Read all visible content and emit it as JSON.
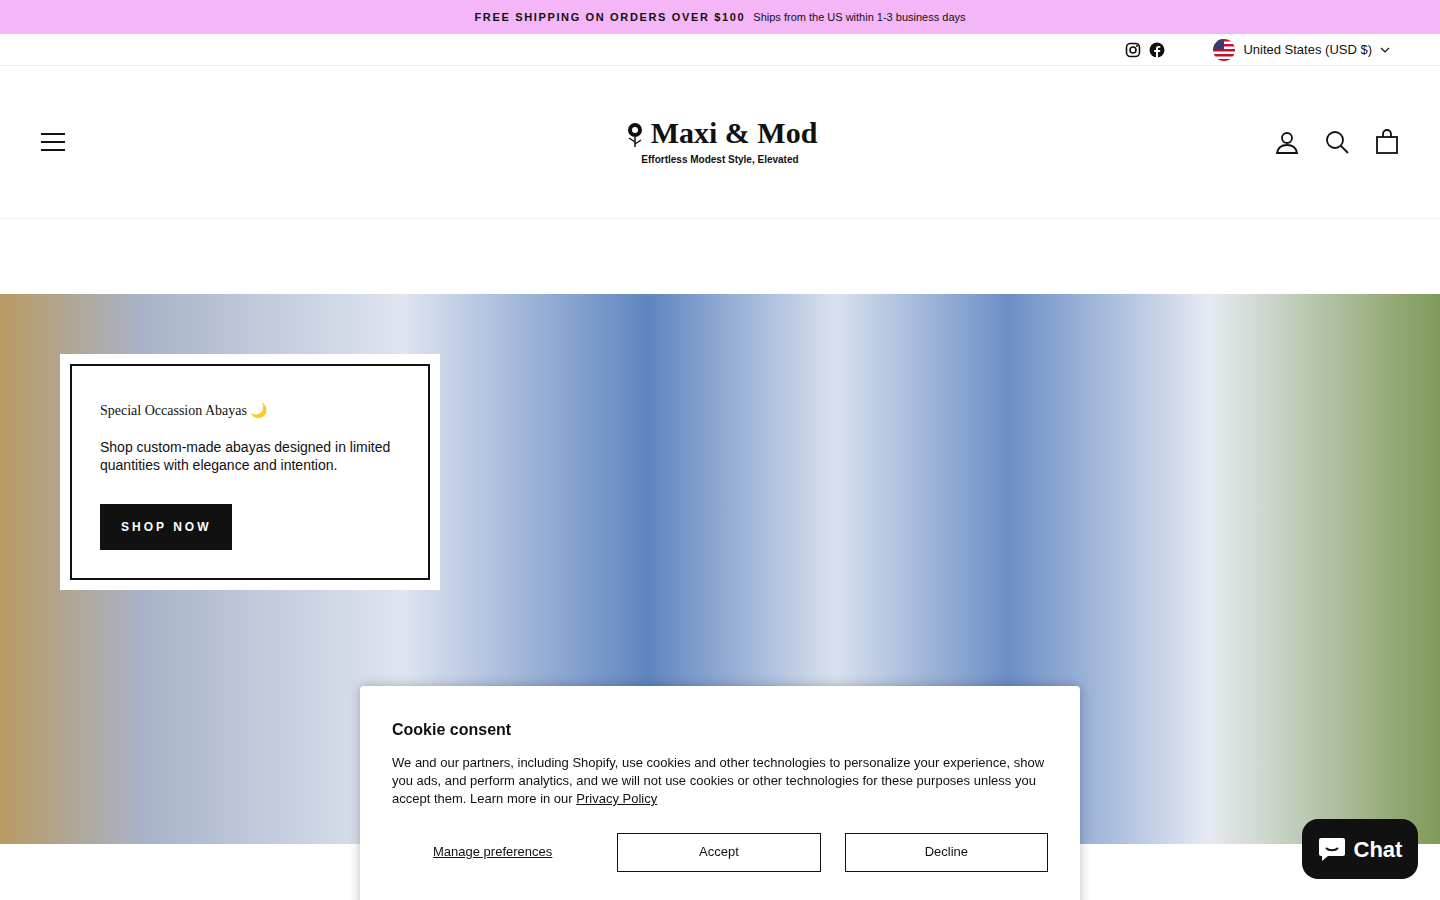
{
  "announcement": {
    "headline": "FREE SHIPPING ON ORDERS OVER $100",
    "detail": "Ships from the US within 1-3 business days"
  },
  "utility": {
    "country": "United States (USD $)"
  },
  "logo": {
    "name": "Maxi & Mod",
    "tagline": "Effortless Modest Style, Elevated"
  },
  "hero": {
    "subtitle": "Special Occassion Abayas 🌙",
    "text": "Shop custom-made abayas designed in limited quantities with elegance and intention.",
    "button": "SHOP NOW"
  },
  "cookie": {
    "title": "Cookie consent",
    "text": "We and our partners, including Shopify, use cookies and other technologies to personalize your experience, show you ads, and perform analytics, and we will not use cookies or other technologies for these purposes unless you accept them. Learn more in our ",
    "link": "Privacy Policy",
    "buttons": [
      {
        "label": "Manage preferences",
        "kind": "link"
      },
      {
        "label": "Accept",
        "kind": "box"
      },
      {
        "label": "Decline",
        "kind": "box"
      }
    ]
  },
  "chat": {
    "label": "Chat"
  }
}
